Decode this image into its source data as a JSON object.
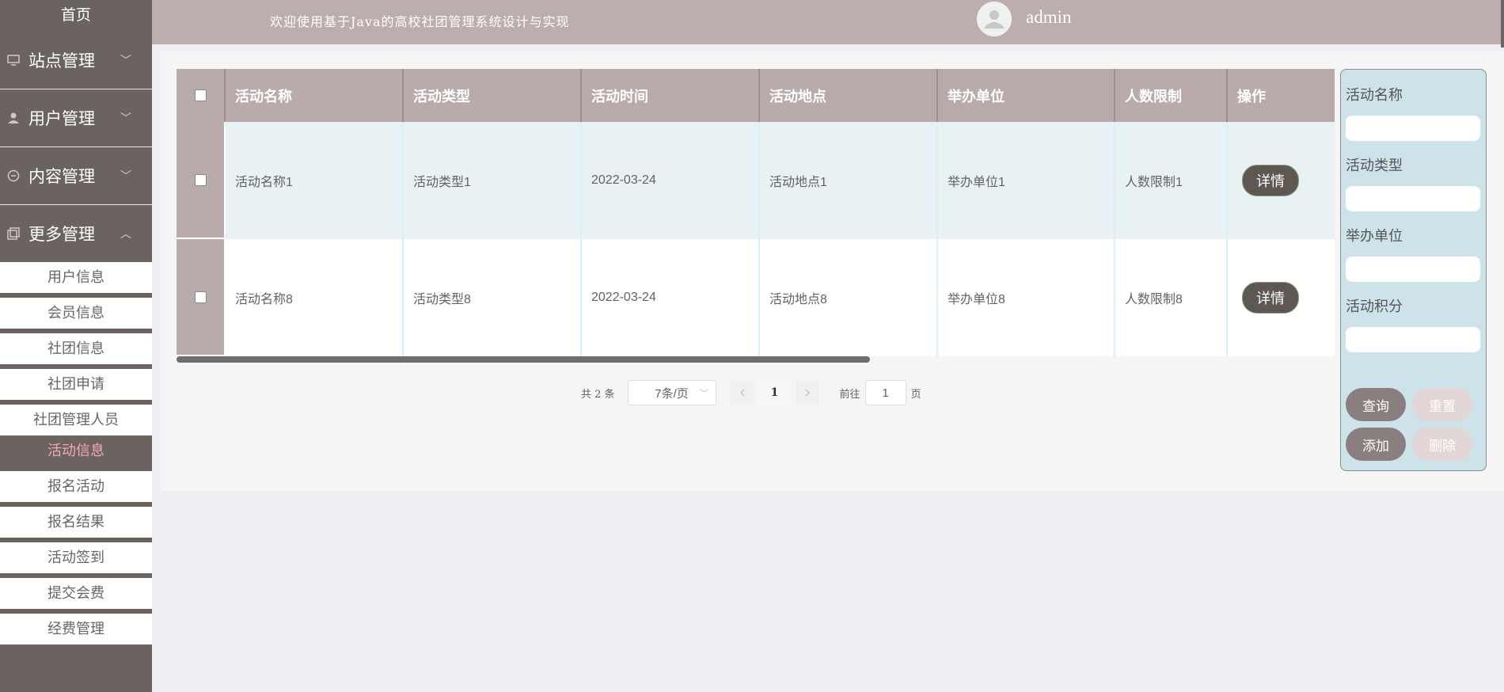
{
  "sidebar": {
    "home": "首页",
    "groups": [
      {
        "label": "站点管理",
        "icon": "monitor-icon"
      },
      {
        "label": "用户管理",
        "icon": "user-icon"
      },
      {
        "label": "内容管理",
        "icon": "chat-icon"
      },
      {
        "label": "更多管理",
        "icon": "copy-icon"
      }
    ],
    "sub_items": [
      "用户信息",
      "会员信息",
      "社团信息",
      "社团申请",
      "社团管理人员",
      "活动信息",
      "报名活动",
      "报名结果",
      "活动签到",
      "提交会费",
      "经费管理"
    ],
    "active_item": "活动信息"
  },
  "header": {
    "welcome": "欢迎使用基于Java的高校社团管理系统设计与实现",
    "username": "admin"
  },
  "table": {
    "columns": [
      "活动名称",
      "活动类型",
      "活动时间",
      "活动地点",
      "举办单位",
      "人数限制",
      "操作"
    ],
    "rows": [
      {
        "name": "活动名称1",
        "type": "活动类型1",
        "time": "2022-03-24",
        "place": "活动地点1",
        "org": "举办单位1",
        "limit": "人数限制1",
        "action": "详情"
      },
      {
        "name": "活动名称8",
        "type": "活动类型8",
        "time": "2022-03-24",
        "place": "活动地点8",
        "org": "举办单位8",
        "limit": "人数限制8",
        "action": "详情"
      }
    ]
  },
  "pagination": {
    "total": "共 2 条",
    "page_size": "7条/页",
    "current_page": "1",
    "goto_label": "前往",
    "goto_value": "1",
    "page_suffix": "页"
  },
  "search": {
    "labels": [
      "活动名称",
      "活动类型",
      "举办单位",
      "活动积分"
    ],
    "query": "查询",
    "reset": "重置",
    "add": "添加",
    "delete": "删除"
  },
  "colors": {
    "sidebar_bg": "#6b6360",
    "header_bg": "#bcaeae",
    "table_header_bg": "#b9abab",
    "active_text": "#f3a8b8",
    "panel_bg": "#cde2e9"
  }
}
